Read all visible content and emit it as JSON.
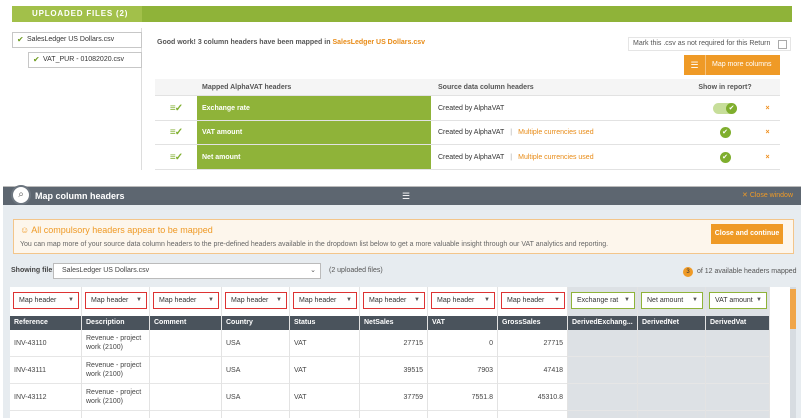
{
  "uploaded_files": {
    "title": "UPLOADED FILES (2)",
    "files": [
      "SalesLedger US Dollars.csv",
      "VAT_PUR - 01082020.csv"
    ]
  },
  "summary": {
    "message_prefix": "Good work! 3 column headers have been mapped in ",
    "message_file": "SalesLedger US Dollars.csv",
    "not_required_label": "Mark this .csv as not required for this Return",
    "map_more_label": "Map more columns"
  },
  "mapped_table": {
    "headers": [
      "Mapped AlphaVAT headers",
      "Source data column headers",
      "Show in report?"
    ],
    "rows": [
      {
        "header": "Exchange rate",
        "source": "Created by AlphaVAT",
        "warning": ""
      },
      {
        "header": "VAT amount",
        "source": "Created by AlphaVAT",
        "warning": "Multiple currencies used"
      },
      {
        "header": "Net amount",
        "source": "Created by AlphaVAT",
        "warning": "Multiple currencies used"
      }
    ],
    "remove_symbol": "×",
    "separator": "|"
  },
  "panel": {
    "title": "Map column headers",
    "close_label": "Close window",
    "close_symbol": "✕",
    "alert_title": "All compulsory headers appear to be mapped",
    "alert_text": "You can map more of your source data column headers to the pre-defined headers available in the dropdown list below to get a more valuable insight through our VAT analytics and reporting.",
    "alert_button": "Close and continue",
    "showing_label": "Showing file:",
    "showing_value": "SalesLedger US Dollars.csv",
    "uploaded_count": "(2 uploaded files)",
    "mapped_count": "3",
    "mapped_suffix": "of 12 available headers mapped"
  },
  "grid": {
    "columns": [
      {
        "name": "Reference",
        "dropdown": "Map header",
        "derived": false
      },
      {
        "name": "Description",
        "dropdown": "Map header",
        "derived": false
      },
      {
        "name": "Comment",
        "dropdown": "Map header",
        "derived": false
      },
      {
        "name": "Country",
        "dropdown": "Map header",
        "derived": false
      },
      {
        "name": "Status",
        "dropdown": "Map header",
        "derived": false
      },
      {
        "name": "NetSales",
        "dropdown": "Map header",
        "derived": false
      },
      {
        "name": "VAT",
        "dropdown": "Map header",
        "derived": false
      },
      {
        "name": "GrossSales",
        "dropdown": "Map header",
        "derived": false
      },
      {
        "name": "DerivedExchang...",
        "dropdown": "Exchange rat",
        "derived": true
      },
      {
        "name": "DerivedNet",
        "dropdown": "Net amount",
        "derived": true
      },
      {
        "name": "DerivedVat",
        "dropdown": "VAT amount",
        "derived": true
      }
    ],
    "rows": [
      [
        "INV-43110",
        "Revenue - project work (2100)",
        "",
        "USA",
        "VAT",
        "27715",
        "0",
        "27715",
        "",
        "",
        ""
      ],
      [
        "INV-43111",
        "Revenue - project work (2100)",
        "",
        "USA",
        "VAT",
        "39515",
        "7903",
        "47418",
        "",
        "",
        ""
      ],
      [
        "INV-43112",
        "Revenue - project work (2100)",
        "",
        "USA",
        "VAT",
        "37759",
        "7551.8",
        "45310.8",
        "",
        "",
        ""
      ]
    ]
  },
  "colors": {
    "accent_green": "#8fb339",
    "accent_orange": "#ef9a26",
    "dark_header": "#4a535c"
  }
}
